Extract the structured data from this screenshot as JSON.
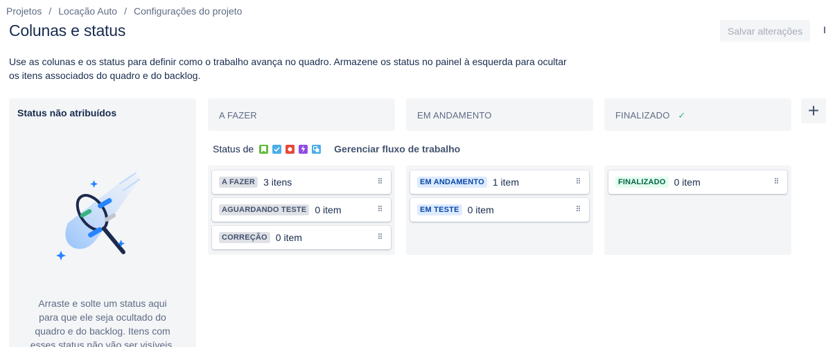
{
  "breadcrumb": {
    "items": [
      "Projetos",
      "Locação Auto",
      "Configurações do projeto"
    ],
    "separator": "/"
  },
  "page_title": "Colunas e status",
  "save_button": "Salvar alterações",
  "edge_char": "I",
  "description": "Use as colunas e os status para definir como o trabalho avança no quadro. Armazene os status no painel à esquerda para ocultar os itens associados do quadro e do backlog.",
  "unassigned": {
    "title": "Status não atribuídos",
    "text": "Arraste e solte um status aqui para que ele seja ocultado do quadro e do backlog. Itens com esses status não vão ser visíveis."
  },
  "workflow": {
    "label": "Status de",
    "manage_link": "Gerenciar fluxo de trabalho",
    "icons": [
      {
        "name": "story-icon",
        "color": "#63ba3c"
      },
      {
        "name": "task-icon",
        "color": "#4bade8"
      },
      {
        "name": "bug-icon",
        "color": "#e5493a"
      },
      {
        "name": "epic-icon",
        "color": "#904ee2"
      },
      {
        "name": "subtask-icon",
        "color": "#4bade8"
      }
    ]
  },
  "columns": [
    {
      "title": "A FAZER",
      "statuses": [
        {
          "name": "A FAZER",
          "count": "3 itens",
          "color": "gray"
        },
        {
          "name": "AGUARDANDO TESTE",
          "count": "0 item",
          "color": "gray"
        },
        {
          "name": "CORREÇÃO",
          "count": "0 item",
          "color": "gray"
        }
      ]
    },
    {
      "title": "EM ANDAMENTO",
      "statuses": [
        {
          "name": "EM ANDAMENTO",
          "count": "1 item",
          "color": "blue"
        },
        {
          "name": "EM TESTE",
          "count": "0 item",
          "color": "blue"
        }
      ]
    },
    {
      "title": "FINALIZADO",
      "done_icon": "check-icon",
      "statuses": [
        {
          "name": "FINALIZADO",
          "count": "0 item",
          "color": "green"
        }
      ]
    }
  ],
  "add_column": "+"
}
